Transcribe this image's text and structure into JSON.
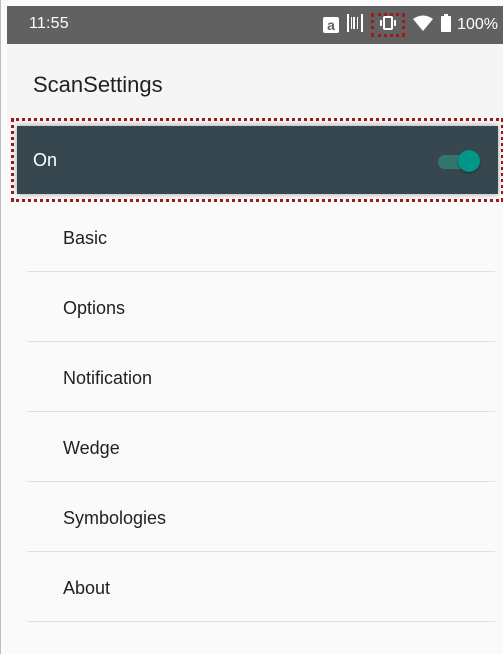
{
  "status_bar": {
    "time": "11:55",
    "icons": [
      "a-icon",
      "barcode-icon",
      "vibrate-icon",
      "wifi-icon",
      "battery-icon"
    ],
    "a_glyph": "a",
    "battery": "100%"
  },
  "app_bar": {
    "title": "ScanSettings"
  },
  "master_switch": {
    "label": "On",
    "state": "on",
    "accent": "#009688",
    "bar_color": "#37474f"
  },
  "menu": {
    "items": [
      {
        "label": "Basic"
      },
      {
        "label": "Options"
      },
      {
        "label": "Notification"
      },
      {
        "label": "Wedge"
      },
      {
        "label": "Symbologies"
      },
      {
        "label": "About"
      }
    ]
  },
  "colors": {
    "status_bar": "#616161",
    "highlight_outline": "#9e1b1b"
  }
}
